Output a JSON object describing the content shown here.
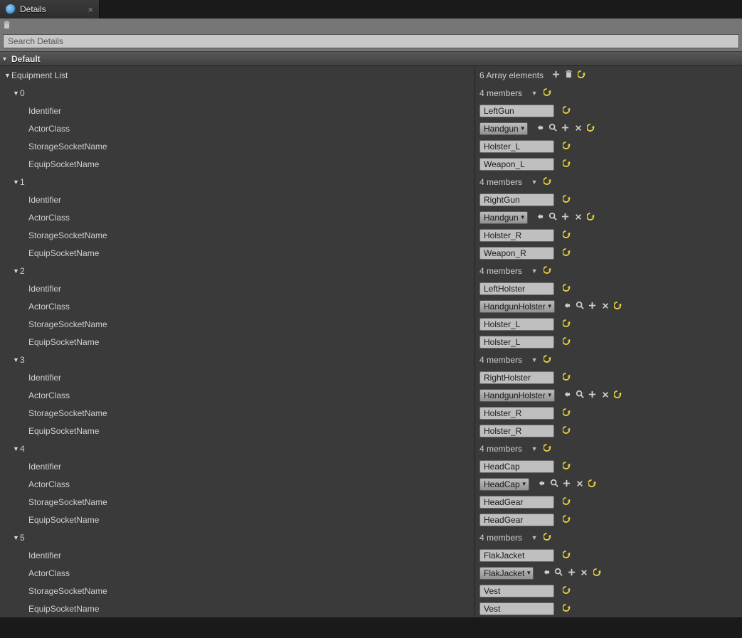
{
  "tab": {
    "title": "Details"
  },
  "search": {
    "placeholder": "Search Details"
  },
  "category": {
    "name": "Default"
  },
  "equipmentList": {
    "label": "Equipment List",
    "summary": "6 Array elements",
    "items": [
      {
        "index": "0",
        "members": "4 members",
        "identifierLabel": "Identifier",
        "identifier": "LeftGun",
        "actorClassLabel": "ActorClass",
        "actorClass": "Handgun",
        "storageSocketLabel": "StorageSocketName",
        "storageSocket": "Holster_L",
        "equipSocketLabel": "EquipSocketName",
        "equipSocket": "Weapon_L"
      },
      {
        "index": "1",
        "members": "4 members",
        "identifierLabel": "Identifier",
        "identifier": "RightGun",
        "actorClassLabel": "ActorClass",
        "actorClass": "Handgun",
        "storageSocketLabel": "StorageSocketName",
        "storageSocket": "Holster_R",
        "equipSocketLabel": "EquipSocketName",
        "equipSocket": "Weapon_R"
      },
      {
        "index": "2",
        "members": "4 members",
        "identifierLabel": "Identifier",
        "identifier": "LeftHolster",
        "actorClassLabel": "ActorClass",
        "actorClass": "HandgunHolster",
        "storageSocketLabel": "StorageSocketName",
        "storageSocket": "Holster_L",
        "equipSocketLabel": "EquipSocketName",
        "equipSocket": "Holster_L"
      },
      {
        "index": "3",
        "members": "4 members",
        "identifierLabel": "Identifier",
        "identifier": "RightHolster",
        "actorClassLabel": "ActorClass",
        "actorClass": "HandgunHolster",
        "storageSocketLabel": "StorageSocketName",
        "storageSocket": "Holster_R",
        "equipSocketLabel": "EquipSocketName",
        "equipSocket": "Holster_R"
      },
      {
        "index": "4",
        "members": "4 members",
        "identifierLabel": "Identifier",
        "identifier": "HeadCap",
        "actorClassLabel": "ActorClass",
        "actorClass": "HeadCap",
        "storageSocketLabel": "StorageSocketName",
        "storageSocket": "HeadGear",
        "equipSocketLabel": "EquipSocketName",
        "equipSocket": "HeadGear"
      },
      {
        "index": "5",
        "members": "4 members",
        "identifierLabel": "Identifier",
        "identifier": "FlakJacket",
        "actorClassLabel": "ActorClass",
        "actorClass": "FlakJacket",
        "storageSocketLabel": "StorageSocketName",
        "storageSocket": "Vest",
        "equipSocketLabel": "EquipSocketName",
        "equipSocket": "Vest"
      }
    ]
  }
}
